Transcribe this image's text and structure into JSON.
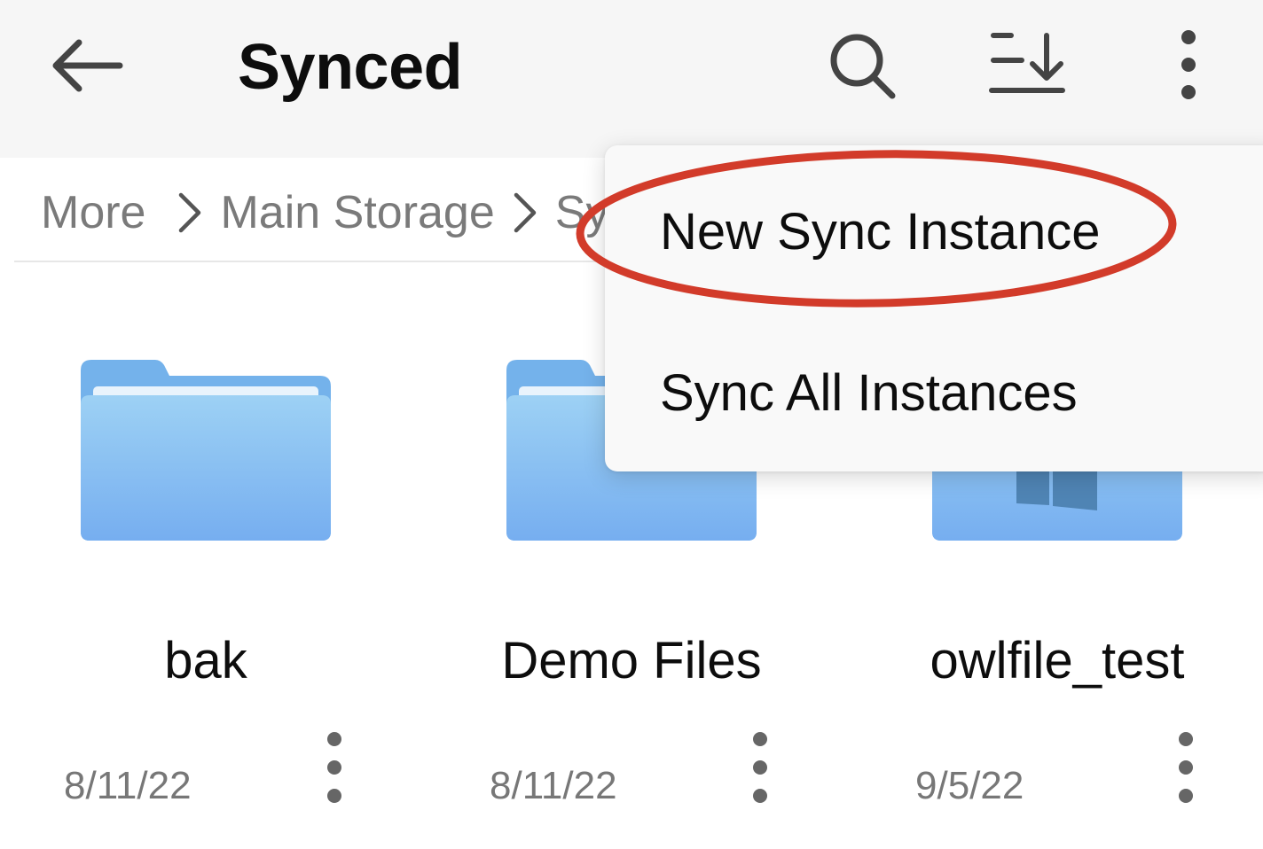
{
  "appbar": {
    "title": "Synced",
    "icons": [
      "back-arrow-icon",
      "search-icon",
      "sort-download-icon",
      "more-vert-icon"
    ]
  },
  "breadcrumb": [
    "More",
    "Main Storage",
    "Sy"
  ],
  "folders": [
    {
      "name": "bak",
      "date": "8/11/22"
    },
    {
      "name": "Demo Files",
      "date": "8/11/22"
    },
    {
      "name": "owlfile_test",
      "date": "9/5/22"
    }
  ],
  "menu": {
    "items": [
      "New Sync Instance",
      "Sync All Instances"
    ],
    "highlighted_item": "New Sync Instance"
  },
  "colors": {
    "appbar_bg": "#f6f6f6",
    "folder_blue": "#7db4ef",
    "annotation_red": "#d23b2a"
  }
}
